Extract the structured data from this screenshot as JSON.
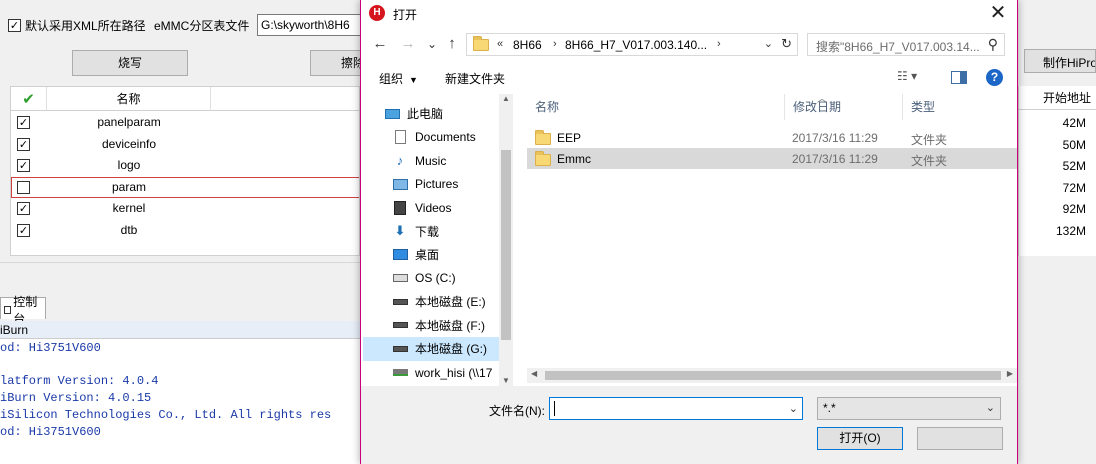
{
  "bg_app": {
    "checkbox_label": "默认采用XML所在路径",
    "checkbox_mark": "✓",
    "emmc_label": "eMMC分区表文件",
    "path_value": "G:\\skyworth\\8H6",
    "burn_button": "烧写",
    "erase_button": "擦除",
    "make_button": "制作HiPro",
    "table": {
      "check_header": "✔",
      "name_header": "名称",
      "start_header": "开始地址",
      "rows": [
        {
          "checked": "✓",
          "name": "panelparam",
          "start": "42M"
        },
        {
          "checked": "✓",
          "name": "deviceinfo",
          "start": "50M"
        },
        {
          "checked": "✓",
          "name": "logo",
          "start": "52M"
        },
        {
          "checked": "",
          "name": "param",
          "start": "72M"
        },
        {
          "checked": "✓",
          "name": "kernel",
          "start": "92M"
        },
        {
          "checked": "✓",
          "name": "dtb",
          "start": "132M"
        }
      ]
    },
    "console_tab": "控制台",
    "console_title": "iBurn",
    "console_lines": [
      "od: Hi3751V600",
      "",
      "latform Version: 4.0.4",
      "iBurn Version: 4.0.15",
      "iSilicon Technologies Co., Ltd. All rights res",
      "od: Hi3751V600"
    ]
  },
  "dialog": {
    "title": "打开",
    "app_icon": "hitool-icon",
    "close_glyph": "✕",
    "nav": {
      "back": "←",
      "forward": "→",
      "recent": "⌄",
      "up": "↑"
    },
    "address": {
      "overflow": "«",
      "crumbs": [
        "8H66",
        "8H66_H7_V017.003.140..."
      ],
      "separator": "›",
      "dropdown": "⌄",
      "refresh": "↻"
    },
    "search_placeholder": "搜索\"8H66_H7_V017.003.14...",
    "toolbar": {
      "organize": "组织",
      "new_folder": "新建文件夹",
      "view_glyph": "☷ ▾",
      "help_glyph": "?"
    },
    "nav_pane": [
      {
        "label": "此电脑",
        "icon": "computer-icon"
      },
      {
        "label": "Documents",
        "icon": "documents-icon"
      },
      {
        "label": "Music",
        "icon": "music-icon"
      },
      {
        "label": "Pictures",
        "icon": "pictures-icon"
      },
      {
        "label": "Videos",
        "icon": "videos-icon"
      },
      {
        "label": "下载",
        "icon": "download-icon"
      },
      {
        "label": "桌面",
        "icon": "desktop-icon"
      },
      {
        "label": "OS (C:)",
        "icon": "os-drive-icon"
      },
      {
        "label": "本地磁盘 (E:)",
        "icon": "drive-icon"
      },
      {
        "label": "本地磁盘 (F:)",
        "icon": "drive-icon"
      },
      {
        "label": "本地磁盘 (G:)",
        "icon": "drive-icon",
        "selected": true
      },
      {
        "label": "work_hisi (\\\\17",
        "icon": "network-drive-icon"
      }
    ],
    "columns": {
      "name": "名称",
      "date": "修改日期",
      "type": "类型"
    },
    "files": [
      {
        "name": "EEP",
        "date": "2017/3/16 11:29",
        "type": "文件夹"
      },
      {
        "name": "Emmc",
        "date": "2017/3/16 11:29",
        "type": "文件夹"
      }
    ],
    "filename_label": "文件名(N):",
    "filename_value": "",
    "filetype_value": "*.*",
    "open_button": "打开(O)"
  }
}
